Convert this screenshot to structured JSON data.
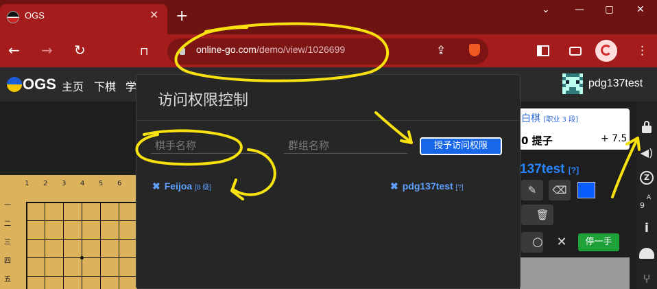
{
  "browser": {
    "tab_title": "OGS",
    "url_host": "online-go.com",
    "url_path": "/demo/view/1026699",
    "win_minimize": "—",
    "win_restore": "▢",
    "win_close": "✕",
    "collapse_chevron": "⌄"
  },
  "site": {
    "logo_text": "OGS",
    "nav": [
      "主页",
      "下棋",
      "学"
    ],
    "username": "pdg137test"
  },
  "board": {
    "col_labels": [
      "1",
      "2",
      "3",
      "4",
      "5",
      "6"
    ],
    "row_labels": [
      "一",
      "二",
      "三",
      "四",
      "五"
    ]
  },
  "player_panel": {
    "white_label": "白棋",
    "white_rank": "[职业 3 段]",
    "captures_prefix": "0",
    "captures_label": "提子",
    "komi": "+ 7.5",
    "player_name": "137test",
    "player_rank": "[?]",
    "pass_label": "停一手"
  },
  "rail": {
    "z_label": "Z",
    "a_label": "A",
    "nine_label": "9",
    "info_label": "i"
  },
  "modal": {
    "title": "访问权限控制",
    "player_placeholder": "棋手名称",
    "group_placeholder": "群组名称",
    "grant_label": "授予访问权限",
    "entries": [
      {
        "name": "Feijoa",
        "rank": "[8 级]"
      },
      {
        "name": "pdg137test",
        "rank": "[?]"
      }
    ]
  },
  "colors": {
    "chrome_red": "#a51c1c",
    "accent_blue": "#1767e8",
    "link_blue": "#5fa0ff",
    "annotation_yellow": "#f7e10e"
  }
}
